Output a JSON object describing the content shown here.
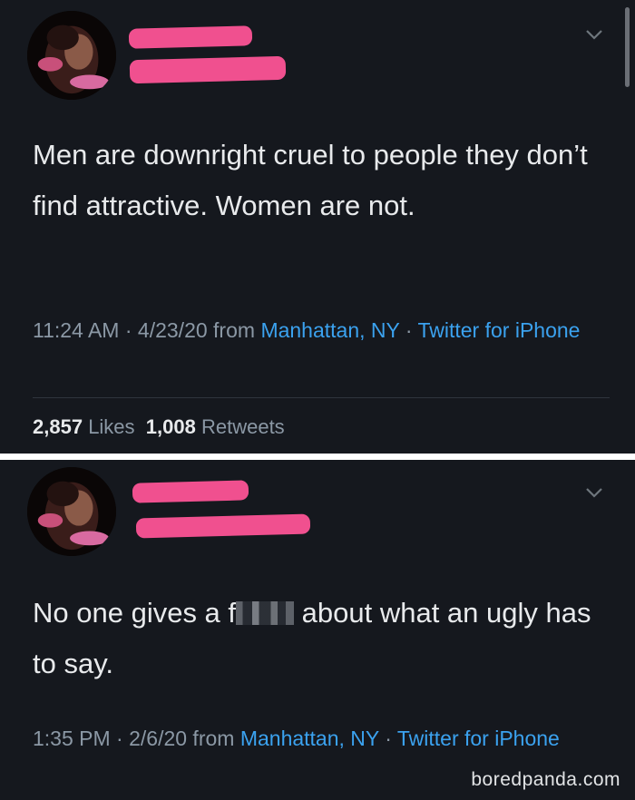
{
  "tweets": [
    {
      "text": "Men are downright cruel to people they don’t find attractive. Women are not.",
      "time_date": "11:24 AM · 4/23/20 from ",
      "location": "Manhattan, NY",
      "separator": " · ",
      "source": "Twitter for iPhone",
      "stats": {
        "likes_count": "2,857",
        "likes_label": "Likes",
        "retweets_count": "1,008",
        "retweets_label": "Retweets"
      }
    },
    {
      "text_before": "No one gives a f",
      "text_after": " about what an ugly has to say.",
      "time_date": "1:35 PM · 2/6/20 from ",
      "location": "Manhattan, NY",
      "separator": " · ",
      "source": "Twitter for iPhone"
    }
  ],
  "watermark": "boredpanda.com",
  "colors": {
    "background": "#15181e",
    "text": "#e8eaec",
    "meta": "#8b98a5",
    "link": "#3ba2ef",
    "redaction": "#f0508f"
  },
  "icons": {
    "caret": "chevron-down-icon"
  }
}
